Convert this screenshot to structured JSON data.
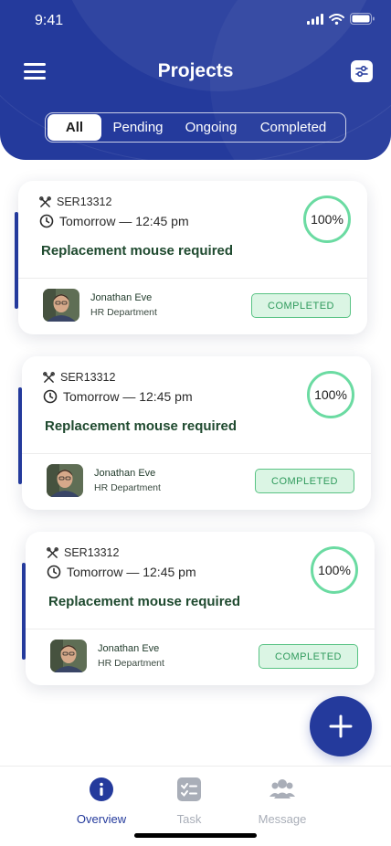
{
  "status_bar": {
    "time": "9:41"
  },
  "header": {
    "title": "Projects"
  },
  "tabs": [
    {
      "label": "All",
      "active": true
    },
    {
      "label": "Pending",
      "active": false
    },
    {
      "label": "Ongoing",
      "active": false
    },
    {
      "label": "Completed",
      "active": false
    }
  ],
  "cards": [
    {
      "id": "SER13312",
      "time": "Tomorrow — 12:45 pm",
      "title": "Replacement mouse required",
      "progress": "100%",
      "person": "Jonathan Eve",
      "department": "HR Department",
      "status": "COMPLETED"
    },
    {
      "id": "SER13312",
      "time": "Tomorrow — 12:45 pm",
      "title": "Replacement mouse required",
      "progress": "100%",
      "person": "Jonathan Eve",
      "department": "HR Department",
      "status": "COMPLETED"
    },
    {
      "id": "SER13312",
      "time": "Tomorrow — 12:45 pm",
      "title": "Replacement mouse required",
      "progress": "100%",
      "person": "Jonathan Eve",
      "department": "HR Department",
      "status": "COMPLETED"
    }
  ],
  "bottom_nav": [
    {
      "label": "Overview",
      "icon": "info-icon",
      "active": true
    },
    {
      "label": "Task",
      "icon": "checklist-icon",
      "active": false
    },
    {
      "label": "Message",
      "icon": "people-icon",
      "active": false
    }
  ],
  "colors": {
    "primary": "#243a9c",
    "success": "#59c384",
    "progress_ring": "#6bdba2",
    "title_text": "#1f4a2f"
  }
}
